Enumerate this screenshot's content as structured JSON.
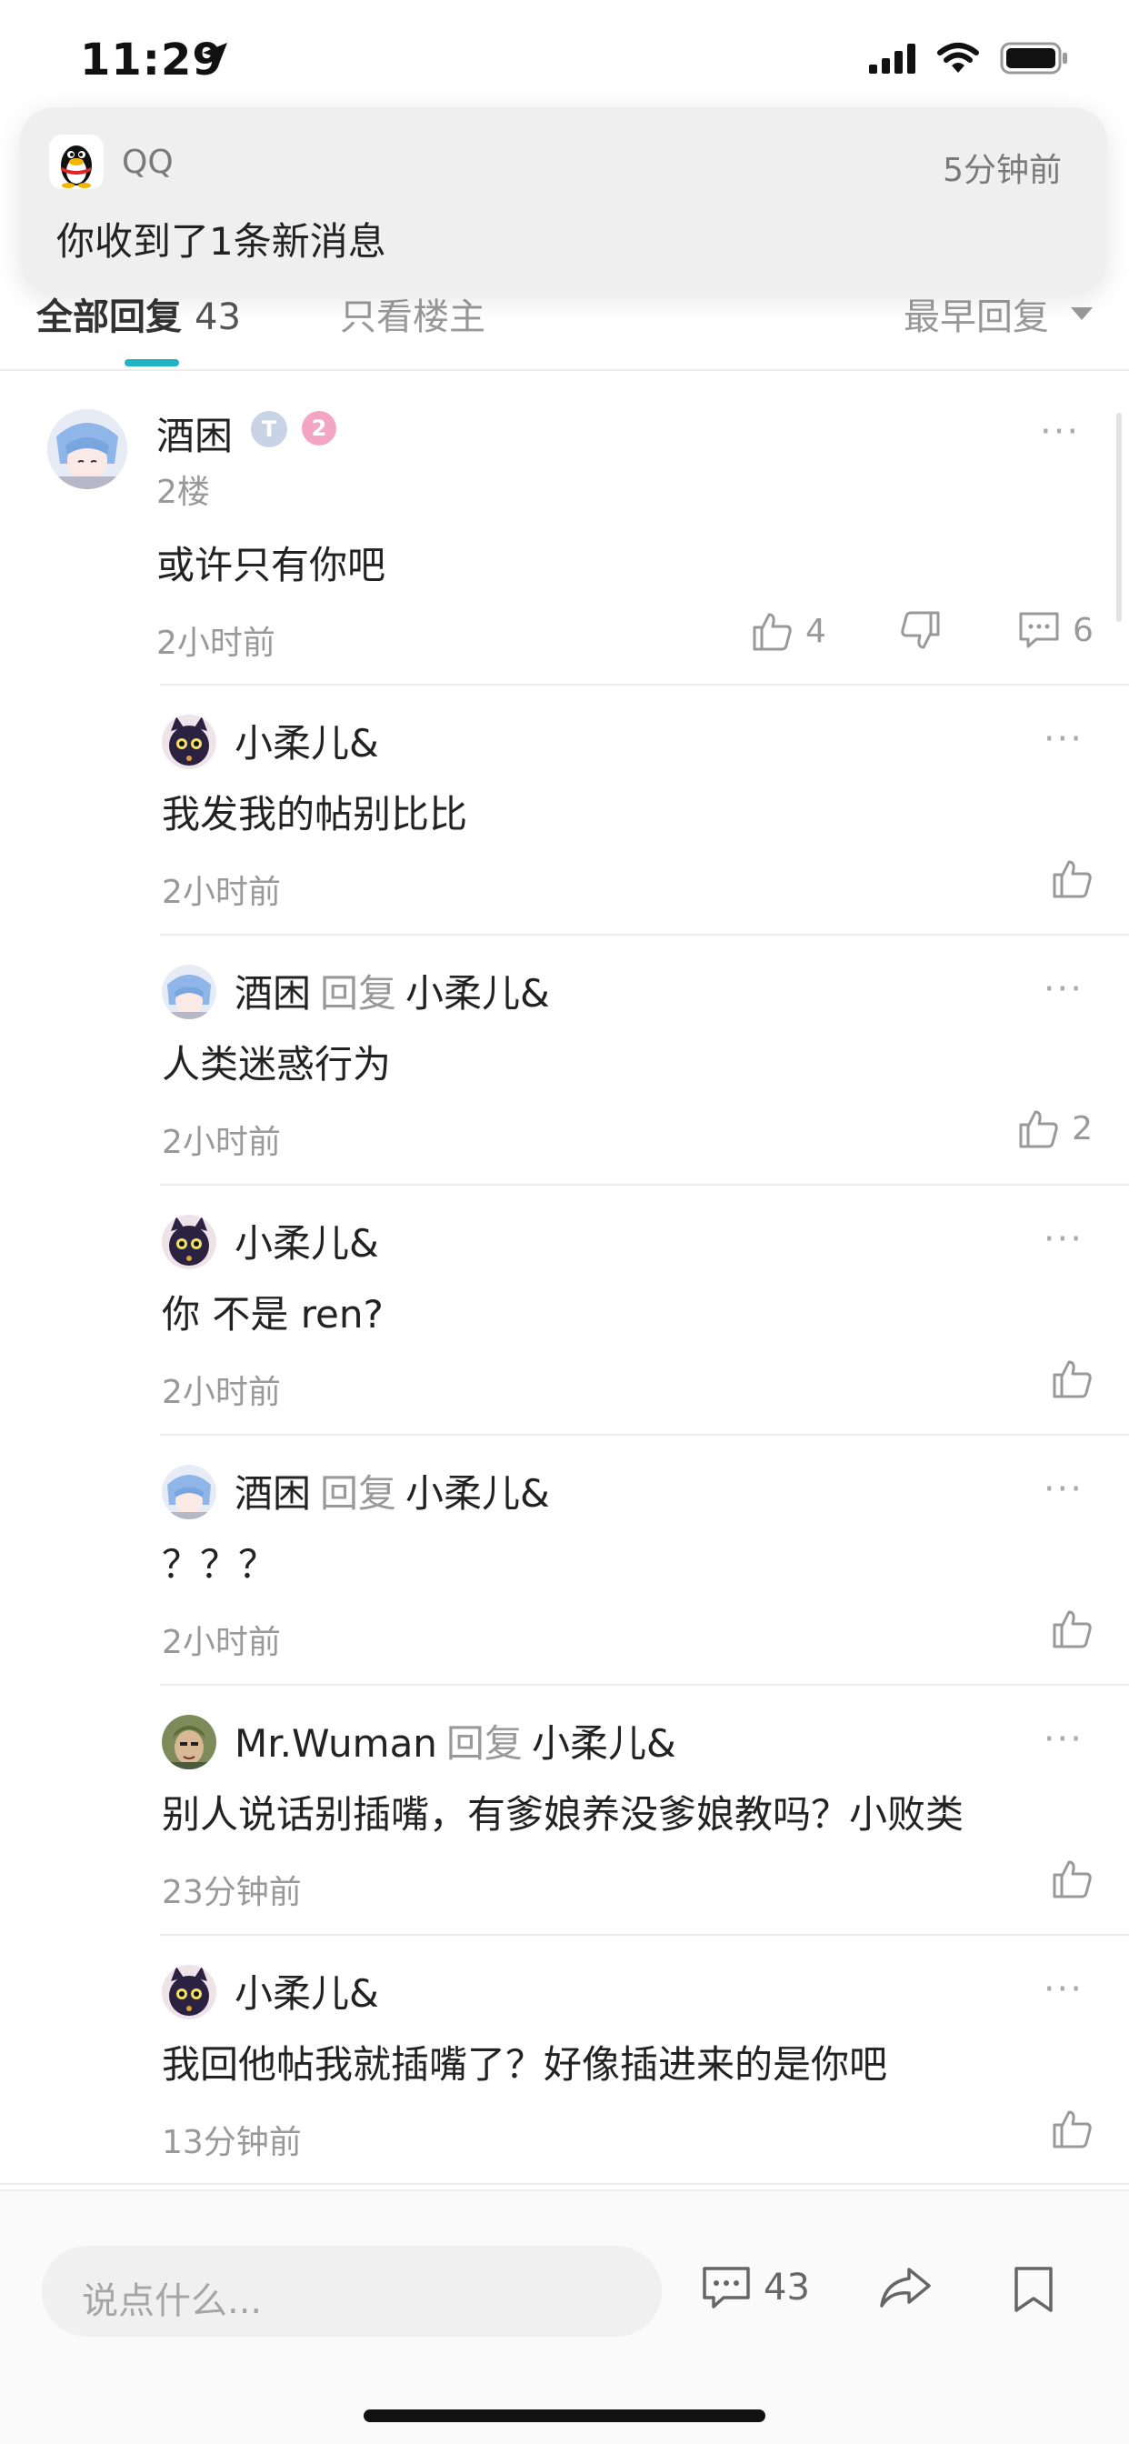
{
  "status_bar": {
    "time": "11:29"
  },
  "notification": {
    "app_name": "QQ",
    "time": "5分钟前",
    "message": "你收到了1条新消息"
  },
  "tabs": {
    "all_label": "全部回复",
    "all_count": "43",
    "op_only_label": "只看楼主",
    "sort_label": "最早回复"
  },
  "main_comment": {
    "author": "酒困",
    "badge_t": "T",
    "level": "2",
    "floor": "2楼",
    "text": "或许只有你吧",
    "time": "2小时前",
    "likes": "4",
    "replies": "6",
    "more": "···"
  },
  "replies": [
    {
      "author": "小柔儿&",
      "reply_word": "",
      "reply_to": "",
      "text": "我发我的帖别比比",
      "time": "2小时前",
      "likes": ""
    },
    {
      "author": "酒困",
      "reply_word": "回复",
      "reply_to": "小柔儿&",
      "text": "人类迷惑行为",
      "time": "2小时前",
      "likes": "2"
    },
    {
      "author": "小柔儿&",
      "reply_word": "",
      "reply_to": "",
      "text": "你 不是 ren?",
      "time": "2小时前",
      "likes": ""
    },
    {
      "author": "酒困",
      "reply_word": "回复",
      "reply_to": "小柔儿&",
      "text": "？？？",
      "time": "2小时前",
      "likes": ""
    },
    {
      "author": "Mr.Wuman",
      "reply_word": "回复",
      "reply_to": "小柔儿&",
      "text": "别人说话别插嘴，有爹娘养没爹娘教吗？小败类",
      "time": "23分钟前",
      "likes": ""
    },
    {
      "author": "小柔儿&",
      "reply_word": "",
      "reply_to": "",
      "text": "我回他帖我就插嘴了？好像插进来的是你吧",
      "time": "13分钟前",
      "likes": ""
    }
  ],
  "bottom_bar": {
    "input_placeholder": "说点什么...",
    "comment_count": "43"
  },
  "colors": {
    "accent": "#1fb3c4",
    "secondary_text": "#999999",
    "primary_text": "#222222",
    "level_badge": "#f3a6c4"
  }
}
